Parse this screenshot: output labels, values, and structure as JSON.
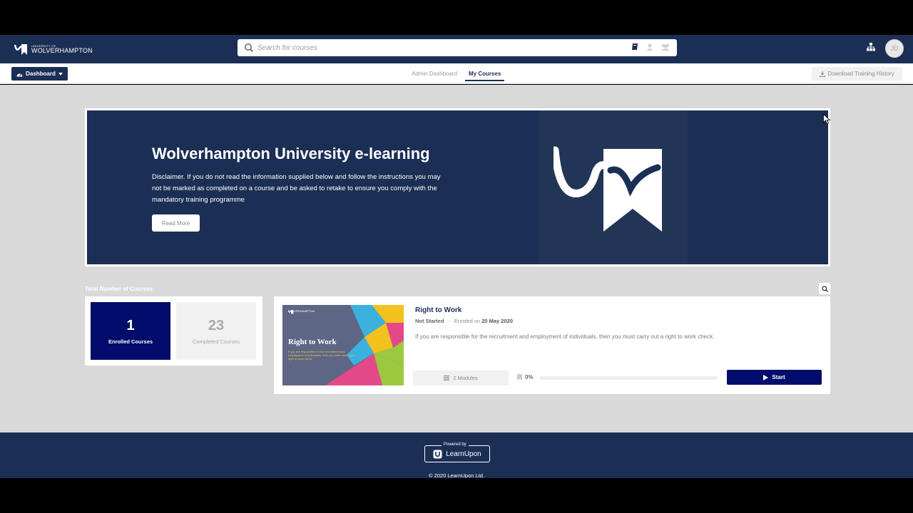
{
  "header": {
    "logo_small": "UNIVERSITY OF",
    "logo_big": "WOLVERHAMPTON",
    "search_placeholder": "Search for courses",
    "avatar_initials": "JD",
    "colors": {
      "navy": "#1b2f55",
      "deep_blue": "#020d6b"
    }
  },
  "subnav": {
    "dashboard_label": "Dashboard",
    "tabs": [
      {
        "label": "Admin Dashboard",
        "active": false
      },
      {
        "label": "My Courses",
        "active": true
      }
    ],
    "download_label": "Download Training History"
  },
  "banner": {
    "title": "Wolverhampton University e-learning",
    "text": "Disclaimer. If you do not read the information supplied below and follow the instructions you may not be marked as completed on a course and be asked to retake to ensure you comply with the mandatory training programme",
    "read_more": "Read More"
  },
  "stats": {
    "section_label": "Total Number of Courses",
    "enrolled_count": "1",
    "enrolled_label": "Enrolled Courses",
    "completed_count": "23",
    "completed_label": "Completed Courses"
  },
  "course": {
    "title": "Right to Work",
    "status": "Not Started",
    "enrolled_prefix": "Enroled on",
    "enrolled_date": "20 May 2020",
    "description": "If you are responsible for the recruitment and employment of individuals, then you must carry out a right to work check.",
    "thumbnail_title": "Right to Work",
    "thumbnail_text": "If you are responsible for the recruitment and employment of individuals, then you must carry out a right to work check.",
    "modules": "2 Modules",
    "progress_label": "0%",
    "progress_value": 0,
    "start_label": "Start"
  },
  "footer": {
    "powered_by": "Powered by",
    "brand": "LearnUpon",
    "copyright": "© 2020 LearnUpon Ltd."
  }
}
